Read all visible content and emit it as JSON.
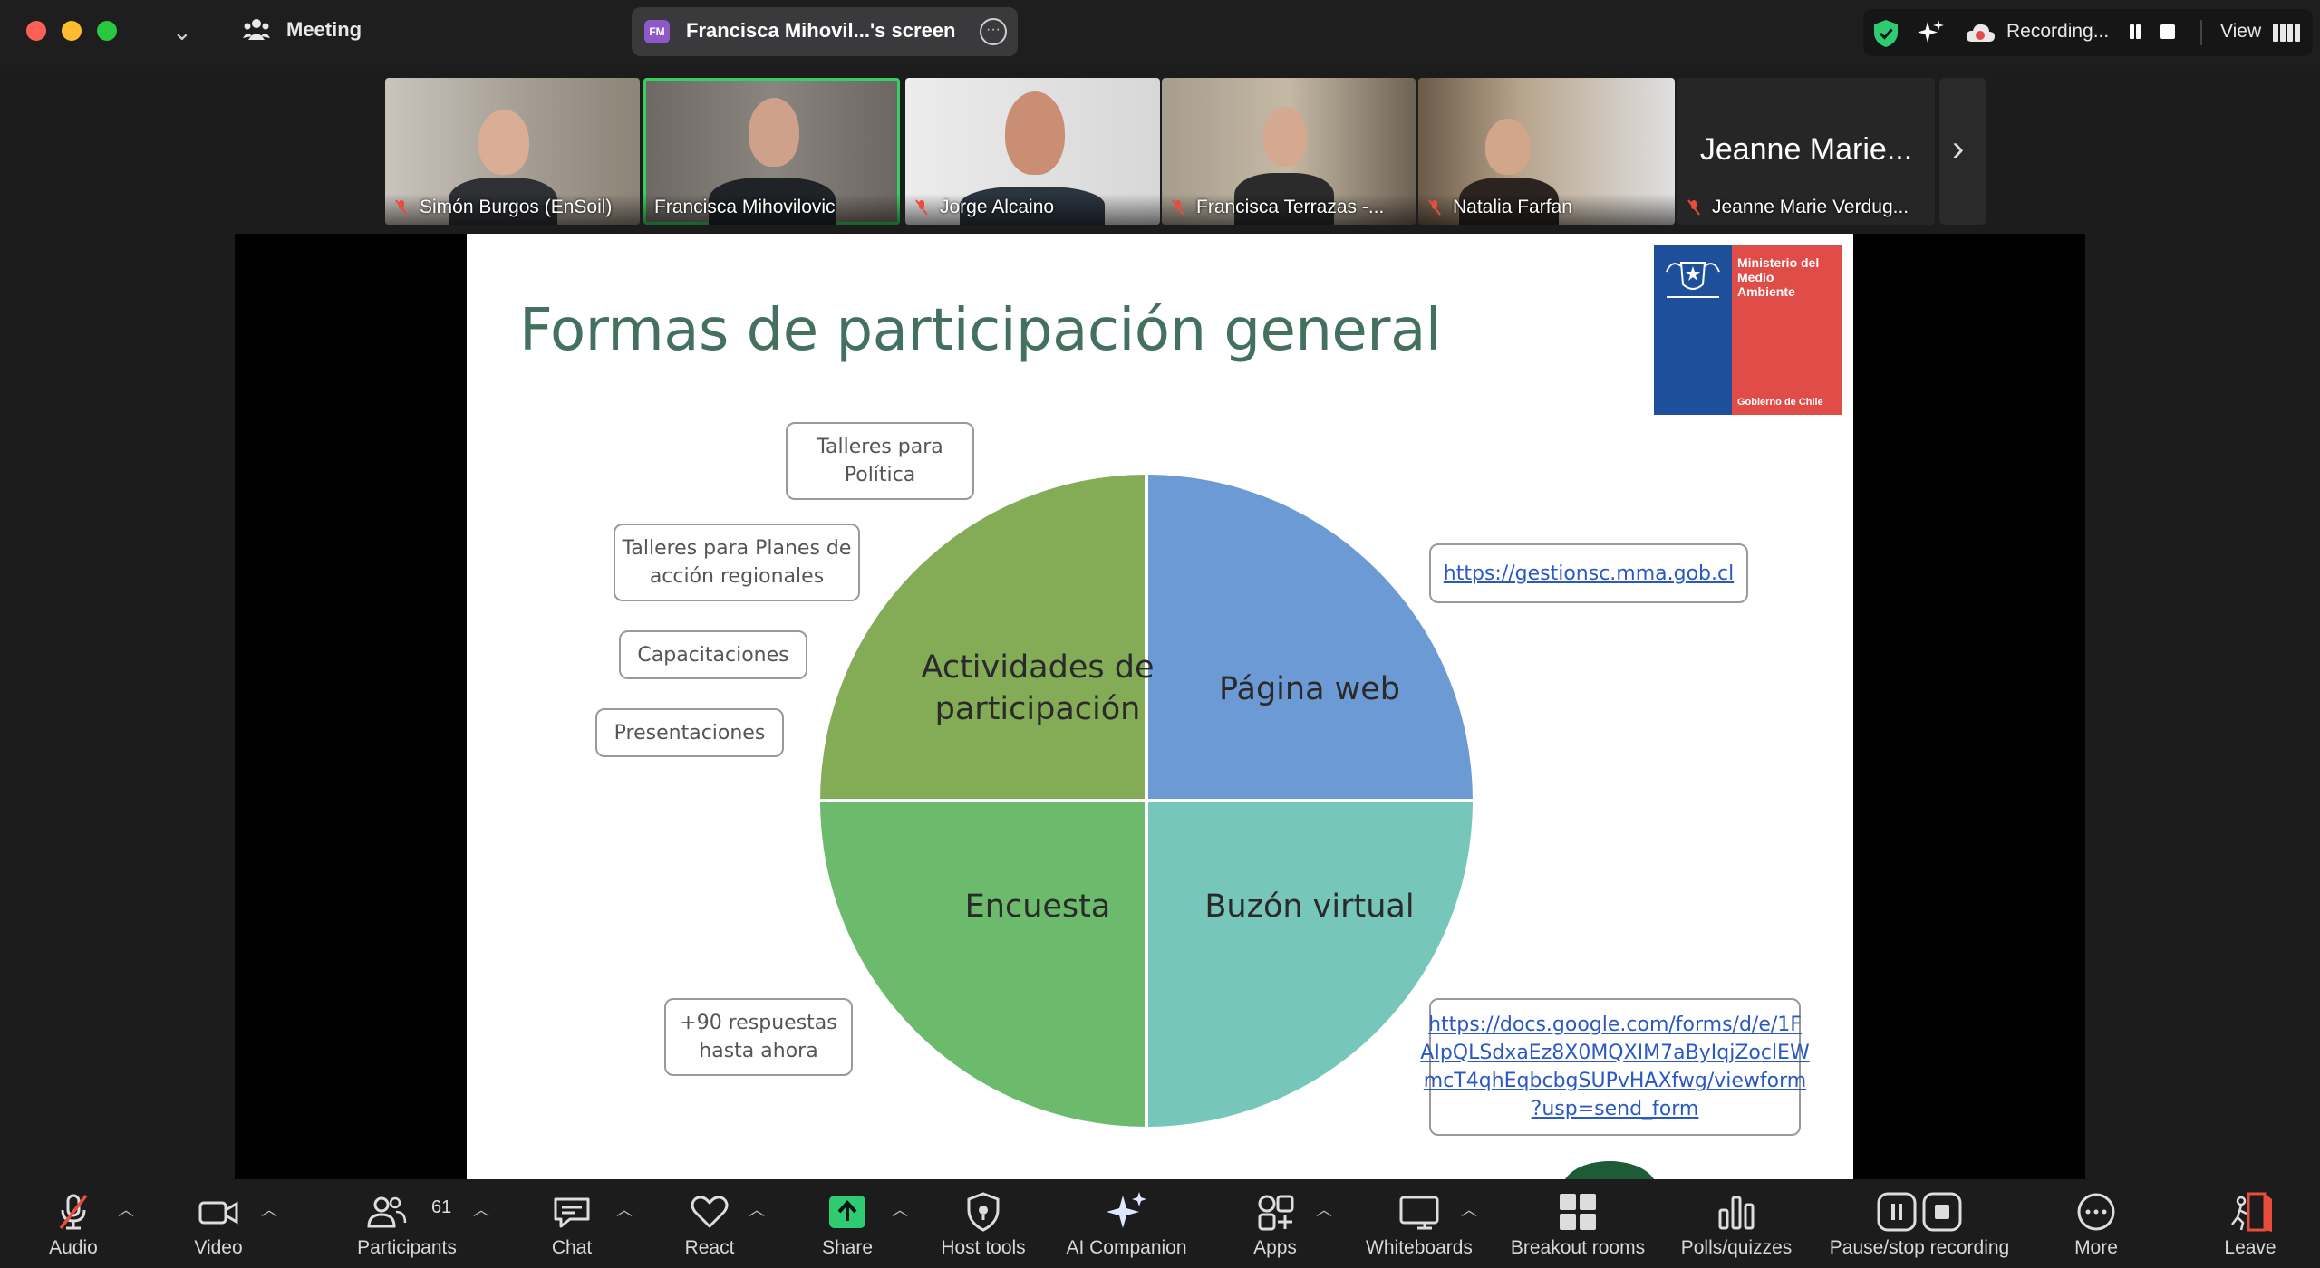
{
  "titlebar": {
    "meeting_label": "Meeting",
    "share_badge": "FM",
    "share_title": "Francisca Mihovil...'s screen",
    "recording_label": "Recording...",
    "view_label": "View"
  },
  "participants_strip": [
    {
      "name": "Simón Burgos (EnSoil)",
      "muted": true,
      "active": false
    },
    {
      "name": "Francisca Mihovilovic",
      "muted": false,
      "active": true
    },
    {
      "name": "Jorge Alcaino",
      "muted": true,
      "active": false
    },
    {
      "name": "Francisca Terrazas -...",
      "muted": true,
      "active": false
    },
    {
      "name": "Natalia Farfan",
      "muted": true,
      "active": false
    },
    {
      "name": "Jeanne Marie Verdug...",
      "muted": true,
      "active": false,
      "big_label": "Jeanne Marie..."
    }
  ],
  "slide": {
    "title": "Formas de participación general",
    "logo_text": [
      "Ministerio del",
      "Medio",
      "Ambiente"
    ],
    "logo_sub": "Gobierno de Chile",
    "boxes": {
      "talleres_politica": [
        "Talleres para",
        "Política"
      ],
      "talleres_planes": [
        "Talleres para Planes de",
        "acción regionales"
      ],
      "capacitaciones": "Capacitaciones",
      "presentaciones": "Presentaciones",
      "respuestas": [
        "+90 respuestas",
        "hasta ahora"
      ],
      "link_web": "https://gestionsc.mma.gob.cl",
      "link_form": [
        "https://docs.google.com/forms/d/e/1F",
        "AIpQLSdxaEz8X0MQXIM7aByIqjZoclEW",
        "mcT4qhEqbcbgSUPvHAXfwg/viewform",
        "?usp=send_form"
      ]
    },
    "quadrants": {
      "top_left": [
        "Actividades de",
        "participación"
      ],
      "top_right": "Página web",
      "bottom_left": "Encuesta",
      "bottom_right": "Buzón virtual"
    },
    "colors": {
      "title": "#44715e",
      "top_left": "#84ac57",
      "top_right": "#6b9ad5",
      "bottom_left": "#6cbb6d",
      "bottom_right": "#76c6b9"
    }
  },
  "toolbar": {
    "audio": "Audio",
    "video": "Video",
    "participants": "Participants",
    "participants_count": "61",
    "chat": "Chat",
    "react": "React",
    "share": "Share",
    "host_tools": "Host tools",
    "ai_companion": "AI Companion",
    "apps": "Apps",
    "whiteboards": "Whiteboards",
    "breakout_rooms": "Breakout rooms",
    "polls": "Polls/quizzes",
    "pause_stop": "Pause/stop recording",
    "more": "More",
    "leave": "Leave"
  }
}
